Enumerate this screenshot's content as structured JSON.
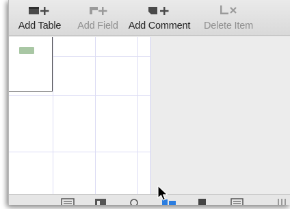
{
  "toolbar": {
    "items": [
      {
        "label": "Add Table",
        "icon": "add-table-icon",
        "enabled": true
      },
      {
        "label": "Add Field",
        "icon": "add-field-icon",
        "enabled": false
      },
      {
        "label": "Add Comment",
        "icon": "add-comment-icon",
        "enabled": true
      },
      {
        "label": "Delete Item",
        "icon": "delete-item-icon",
        "enabled": false
      }
    ]
  },
  "canvas": {
    "grid_color": "#dcdcf4",
    "table_header_color": "#a9c7a4",
    "table_border_color": "#4a4a4a"
  },
  "bottom_toolbar": {
    "icons": [
      "list-icon",
      "table-icon",
      "circle-icon",
      "relationship-icon",
      "square-icon",
      "notes-icon",
      "columns-icon"
    ],
    "accent": "#2b7de0"
  },
  "cursor": "arrow-pointer-icon"
}
